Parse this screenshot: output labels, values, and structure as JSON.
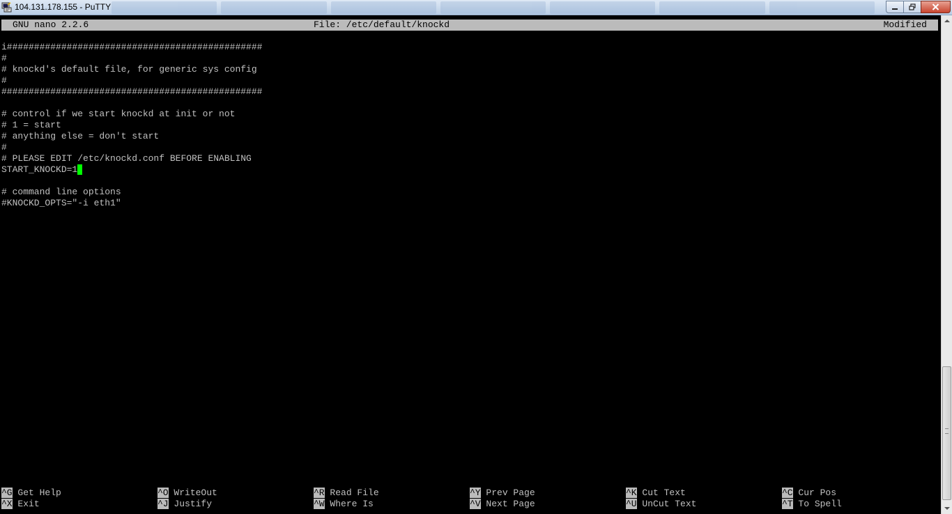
{
  "window": {
    "title": "104.131.178.155 - PuTTY",
    "app_icon": "putty-icon",
    "buttons": [
      "minimize-icon",
      "maximize-icon",
      "close-icon"
    ],
    "close_color": "#c8452f"
  },
  "nano": {
    "version": "GNU nano 2.2.6",
    "file": "File: /etc/default/knockd",
    "status": "Modified"
  },
  "content": {
    "lines": [
      "i###############################################",
      "#",
      "# knockd's default file, for generic sys config",
      "#",
      "################################################",
      "",
      "# control if we start knockd at init or not",
      "# 1 = start",
      "# anything else = don't start",
      "#",
      "# PLEASE EDIT /etc/knockd.conf BEFORE ENABLING",
      "START_KNOCKD=1",
      "",
      "# command line options",
      "#KNOCKD_OPTS=\"-i eth1\""
    ],
    "cursor_color": "#00ff00"
  },
  "shortcuts": [
    {
      "key": "^G",
      "label": "Get Help"
    },
    {
      "key": "^O",
      "label": "WriteOut"
    },
    {
      "key": "^R",
      "label": "Read File"
    },
    {
      "key": "^Y",
      "label": "Prev Page"
    },
    {
      "key": "^K",
      "label": "Cut Text"
    },
    {
      "key": "^C",
      "label": "Cur Pos"
    },
    {
      "key": "^X",
      "label": "Exit"
    },
    {
      "key": "^J",
      "label": "Justify"
    },
    {
      "key": "^W",
      "label": "Where Is"
    },
    {
      "key": "^V",
      "label": "Next Page"
    },
    {
      "key": "^U",
      "label": "UnCut Text"
    },
    {
      "key": "^T",
      "label": "To Spell"
    }
  ]
}
